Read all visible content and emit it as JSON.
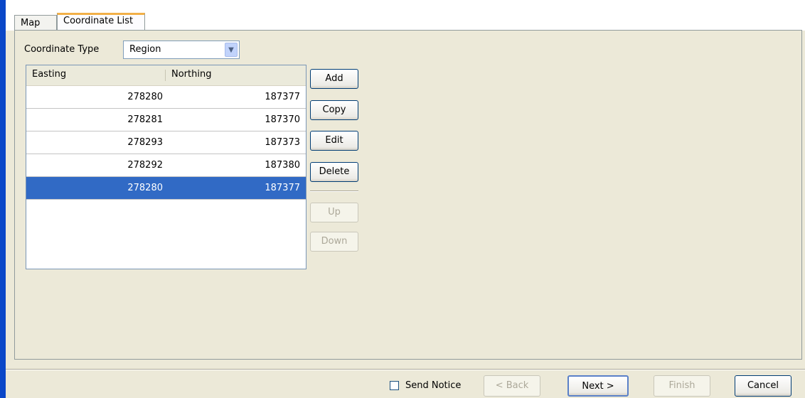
{
  "tabs": [
    "Map",
    "Coordinate List"
  ],
  "coordinate_type": {
    "label": "Coordinate Type",
    "value": "Region"
  },
  "grid": {
    "columns": [
      "Easting",
      "Northing"
    ],
    "rows": [
      {
        "easting": "278280",
        "northing": "187377"
      },
      {
        "easting": "278281",
        "northing": "187370"
      },
      {
        "easting": "278293",
        "northing": "187373"
      },
      {
        "easting": "278292",
        "northing": "187380"
      },
      {
        "easting": "278280",
        "northing": "187377"
      }
    ],
    "selected_row": 4
  },
  "actions": {
    "add": "Add",
    "copy": "Copy",
    "edit": "Edit",
    "delete": "Delete",
    "up": "Up",
    "down": "Down"
  },
  "footer": {
    "send_notice": "Send Notice",
    "back": "< Back",
    "next": "Next >",
    "finish": "Finish",
    "cancel": "Cancel"
  },
  "colors": {
    "selection": "#316ac5",
    "active_tab_accent": "#f2b048",
    "window_bg": "#ece9d8",
    "left_bar": "#0a47c8"
  }
}
